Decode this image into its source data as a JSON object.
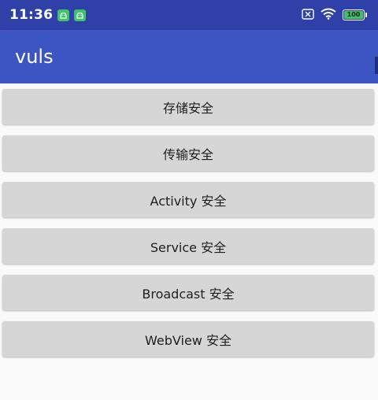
{
  "status_bar": {
    "time": "11:36",
    "battery_level": "100",
    "icons": [
      "android-notification-icon",
      "android-notification-icon",
      "no-sim-icon",
      "wifi-icon",
      "battery-icon"
    ]
  },
  "app_bar": {
    "title": "vuls"
  },
  "colors": {
    "status_bar": "#2f41a8",
    "app_bar": "#3d55c3",
    "button_bg": "#d6d6d6",
    "page_bg": "#fafafa"
  },
  "buttons": [
    {
      "label": "存储安全"
    },
    {
      "label": "传输安全"
    },
    {
      "label": "Activity 安全"
    },
    {
      "label": "Service 安全"
    },
    {
      "label": "Broadcast 安全"
    },
    {
      "label": "WebView 安全"
    }
  ]
}
